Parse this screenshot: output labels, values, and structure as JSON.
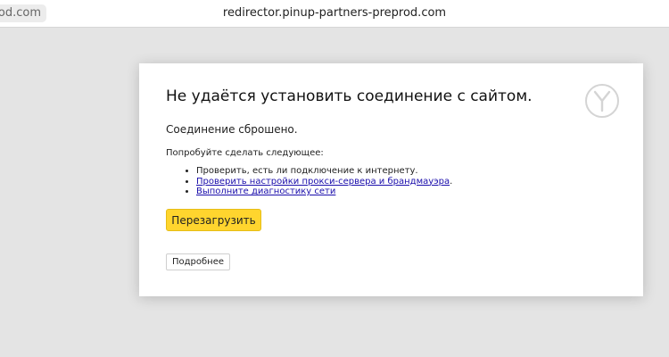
{
  "tab": {
    "url_fragment": "rod.com"
  },
  "window": {
    "domain": "redirector.pinup-partners-preprod.com"
  },
  "error": {
    "heading": "Не удаётся установить соединение с сайтом.",
    "status": "Соединение сброшено.",
    "suggest_intro": "Попробуйте сделать следующее:",
    "suggestions": [
      {
        "text": "Проверить, есть ли подключение к интернету.",
        "link": false
      },
      {
        "text": "Проверить настройки прокси-сервера и брандмауэра",
        "suffix": ".",
        "link": true
      },
      {
        "text": "Выполните диагностику сети",
        "link": true
      }
    ],
    "reload_label": "Перезагрузить",
    "details_label": "Подробнее"
  },
  "icons": {
    "browser_logo": "yandex-browser-logo-icon"
  },
  "colors": {
    "accent_button": "#ffd52e",
    "link": "#1a0dab",
    "background": "#e4e4e4"
  }
}
